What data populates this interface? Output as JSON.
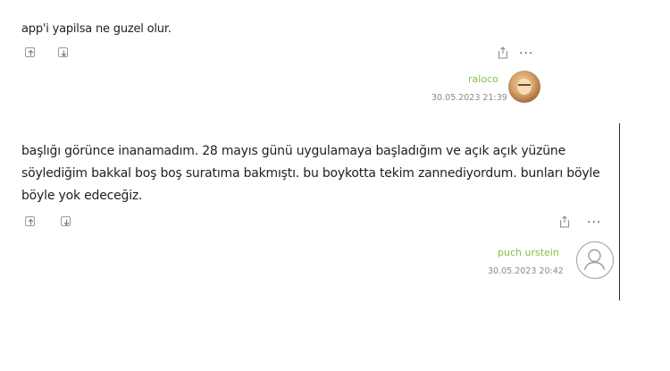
{
  "entries": [
    {
      "text": "app'i yapilsa ne guzel olur.",
      "author": "raloco",
      "date": "30.05.2023 21:39",
      "more": "···"
    },
    {
      "text": "başlığı görünce inanamadım. 28 mayıs günü uygulamaya başladığım ve açık açık yüzüne söylediğim bakkal boş boş suratıma bakmıştı. bu boykotta tekim zannediyordum. bunları böyle böyle yok edeceğiz.",
      "author": "puch urstein",
      "date": "30.05.2023 20:42",
      "more": "···"
    }
  ],
  "colors": {
    "author": "#81c14b",
    "date": "#8a8a8a",
    "text": "#1e1e1e",
    "icon": "#9a9a9a"
  },
  "icons": [
    "upvote-icon",
    "downvote-icon",
    "share-icon",
    "more-icon",
    "avatar-photo",
    "default-avatar-icon"
  ]
}
